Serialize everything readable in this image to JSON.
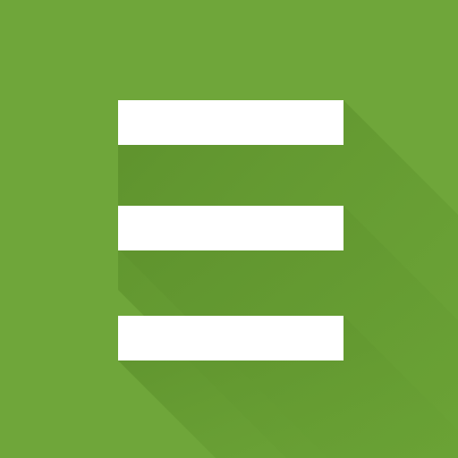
{
  "icon": {
    "name": "hamburger-menu-icon",
    "colors": {
      "background": "#6fa63a",
      "bar": "#ffffff",
      "shadow_near": "#5e922d",
      "shadow_far": "#6aa235"
    },
    "bar_count": 3
  }
}
